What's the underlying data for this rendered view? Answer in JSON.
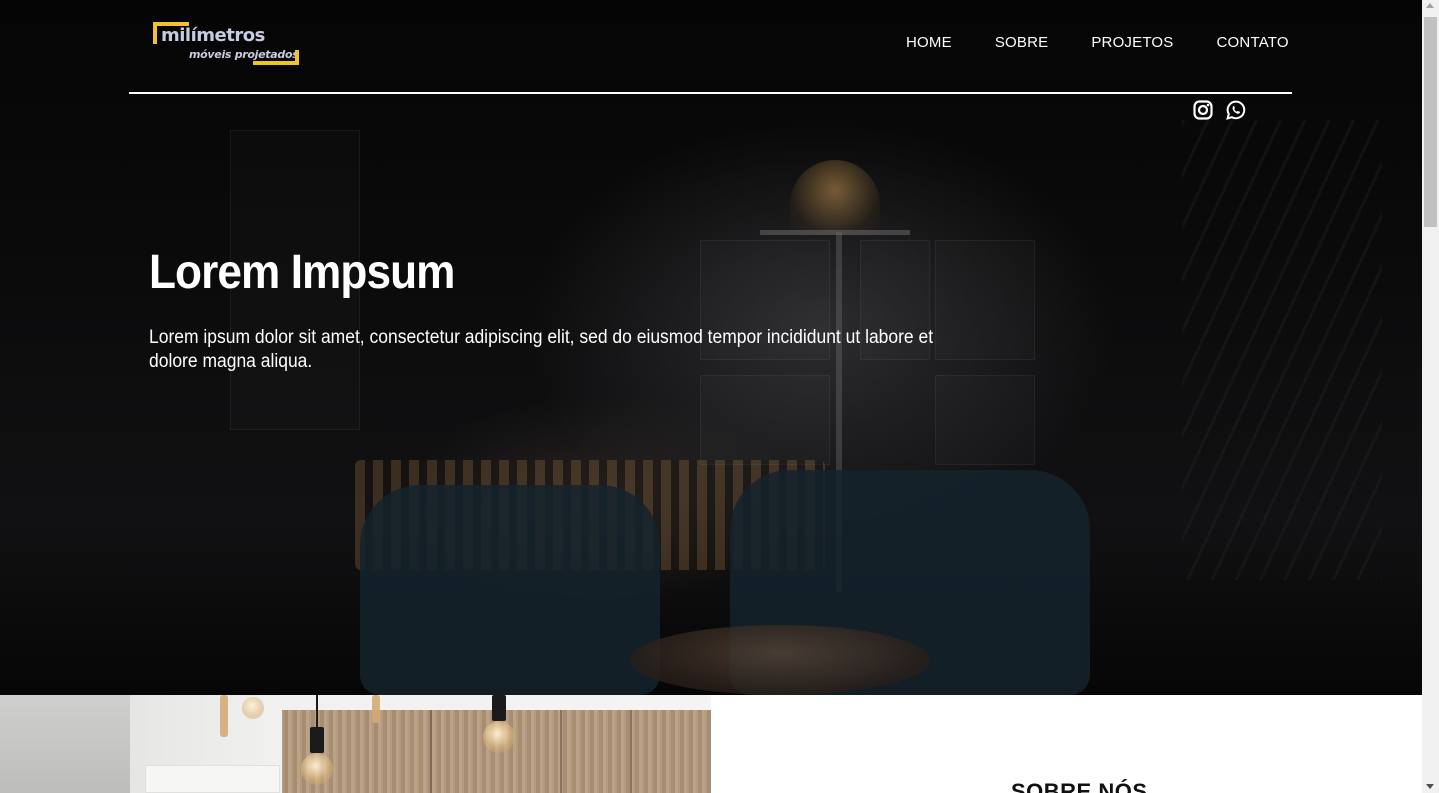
{
  "header": {
    "logo": {
      "main": "milímetros",
      "sub": "móveis projetados",
      "accent_color": "#f2c12e",
      "text_color": "#c9cbe0"
    },
    "nav": [
      {
        "label": "HOME"
      },
      {
        "label": "SOBRE"
      },
      {
        "label": "PROJETOS"
      },
      {
        "label": "CONTATO"
      }
    ],
    "social": [
      {
        "icon": "instagram-icon"
      },
      {
        "icon": "whatsapp-icon"
      }
    ]
  },
  "hero": {
    "title": "Lorem Impsum",
    "text": "Lorem ipsum dolor sit amet, consectetur adipiscing elit, sed do eiusmod tempor incididunt ut labore et dolore magna aliqua."
  },
  "about": {
    "title": "SOBRE NÓS"
  },
  "colors": {
    "hero_bg": "#0b0b0c",
    "text_light": "#ffffff",
    "page_bg": "#ffffff"
  }
}
